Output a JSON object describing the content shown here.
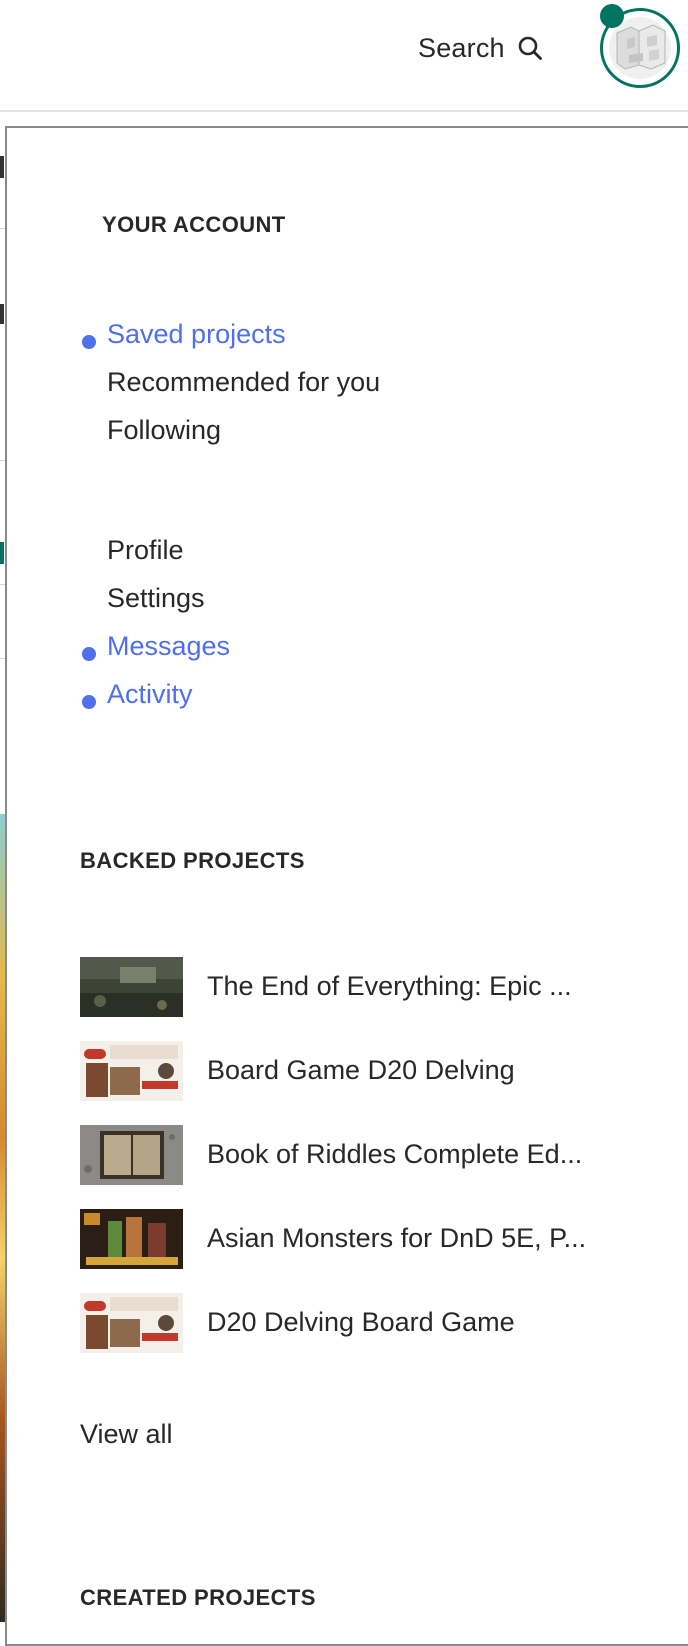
{
  "header": {
    "search_label": "Search",
    "search_icon": "search-icon",
    "avatar_icon": "user-avatar",
    "notification_color": "#037362"
  },
  "account_menu": {
    "heading": "YOUR ACCOUNT",
    "primary_links": [
      {
        "label": "Saved projects",
        "active": true
      },
      {
        "label": "Recommended for you",
        "active": false
      },
      {
        "label": "Following",
        "active": false
      }
    ],
    "secondary_links": [
      {
        "label": "Profile",
        "active": false
      },
      {
        "label": "Settings",
        "active": false
      },
      {
        "label": "Messages",
        "active": true
      },
      {
        "label": "Activity",
        "active": true
      }
    ],
    "active_color": "#4f6fec"
  },
  "backed_projects": {
    "heading": "BACKED PROJECTS",
    "items": [
      {
        "title": "The End of Everything: Epic ..."
      },
      {
        "title": "Board Game D20 Delving"
      },
      {
        "title": "Book of Riddles Complete Ed..."
      },
      {
        "title": "Asian Monsters for DnD 5E, P..."
      },
      {
        "title": "D20 Delving Board Game"
      }
    ],
    "view_all_label": "View all"
  },
  "created_projects": {
    "heading": "CREATED PROJECTS"
  }
}
